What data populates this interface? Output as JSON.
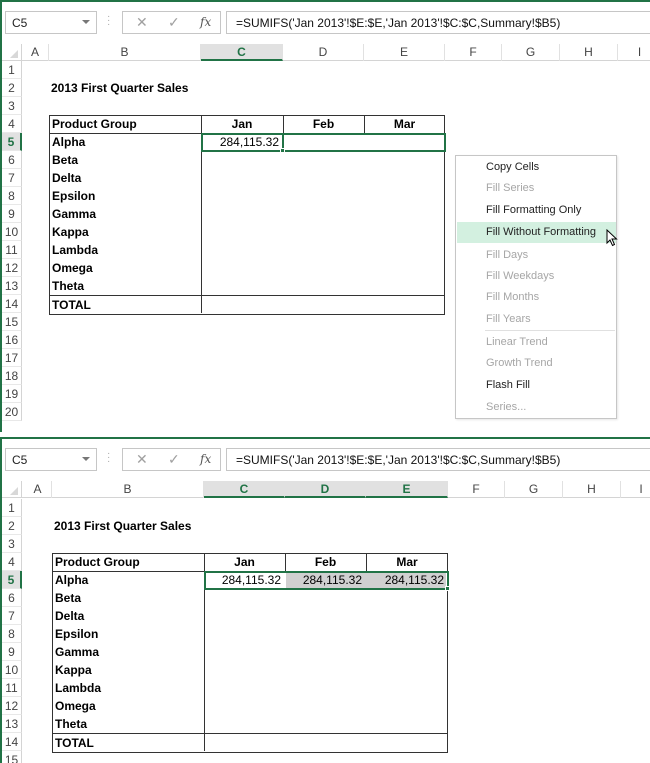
{
  "panels": [
    {
      "name_box": "C5",
      "formula": "=SUMIFS('Jan 2013'!$E:$E,'Jan 2013'!$C:$C,Summary!$B5)",
      "fx_label": "fx",
      "columns": [
        "A",
        "B",
        "C",
        "D",
        "E",
        "F",
        "G",
        "H",
        "I"
      ],
      "selected_columns": [
        "C"
      ],
      "rows": [
        "1",
        "2",
        "3",
        "4",
        "5",
        "6",
        "7",
        "8",
        "9",
        "10",
        "11",
        "12",
        "13",
        "14",
        "15",
        "16",
        "17",
        "18",
        "19",
        "20"
      ],
      "selected_row": "5",
      "title": "2013 First Quarter Sales",
      "table": {
        "headers": [
          "Product Group",
          "Jan",
          "Feb",
          "Mar"
        ],
        "products": [
          "Alpha",
          "Beta",
          "Delta",
          "Epsilon",
          "Gamma",
          "Kappa",
          "Lambda",
          "Omega",
          "Theta"
        ],
        "total_label": "TOTAL",
        "alpha_values": [
          "284,115.32",
          "",
          ""
        ]
      }
    },
    {
      "name_box": "C5",
      "formula": "=SUMIFS('Jan 2013'!$E:$E,'Jan 2013'!$C:$C,Summary!$B5)",
      "fx_label": "fx",
      "columns": [
        "A",
        "B",
        "C",
        "D",
        "E",
        "F",
        "G",
        "H",
        "I"
      ],
      "selected_columns": [
        "C",
        "D",
        "E"
      ],
      "rows": [
        "1",
        "2",
        "3",
        "4",
        "5",
        "6",
        "7",
        "8",
        "9",
        "10",
        "11",
        "12",
        "13",
        "14",
        "15"
      ],
      "selected_row": "5",
      "title": "2013 First Quarter Sales",
      "table": {
        "headers": [
          "Product Group",
          "Jan",
          "Feb",
          "Mar"
        ],
        "products": [
          "Alpha",
          "Beta",
          "Delta",
          "Epsilon",
          "Gamma",
          "Kappa",
          "Lambda",
          "Omega",
          "Theta"
        ],
        "total_label": "TOTAL",
        "alpha_values": [
          "284,115.32",
          "284,115.32",
          "284,115.32"
        ]
      }
    }
  ],
  "autofill_menu": {
    "items": [
      {
        "label": "Copy Cells",
        "enabled": true
      },
      {
        "label": "Fill Series",
        "enabled": false
      },
      {
        "label": "Fill Formatting Only",
        "enabled": true
      },
      {
        "label": "Fill Without Formatting",
        "enabled": true,
        "hovered": true
      },
      {
        "label": "Fill Days",
        "enabled": false
      },
      {
        "label": "Fill Weekdays",
        "enabled": false
      },
      {
        "label": "Fill Months",
        "enabled": false
      },
      {
        "label": "Fill Years",
        "enabled": false
      },
      {
        "label": "Linear Trend",
        "enabled": false
      },
      {
        "label": "Growth Trend",
        "enabled": false
      },
      {
        "label": "Flash Fill",
        "enabled": true
      },
      {
        "label": "Series...",
        "enabled": false
      }
    ]
  },
  "colors": {
    "accent": "#217346",
    "hover": "#d3f0e0",
    "fill_highlight": "#d0d0d0"
  }
}
